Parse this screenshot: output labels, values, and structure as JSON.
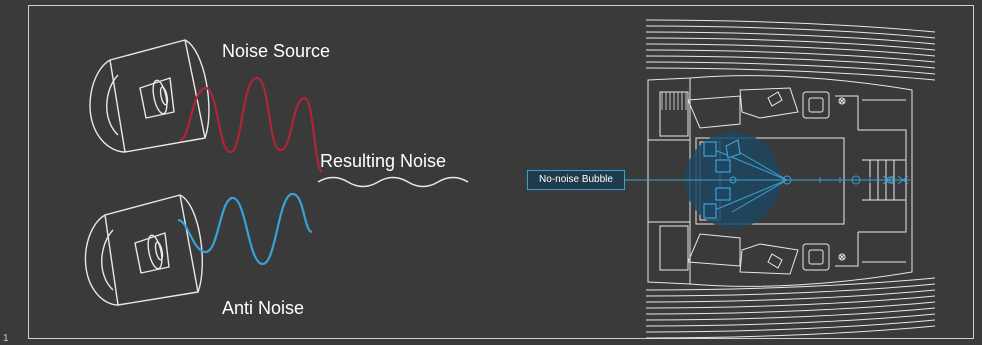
{
  "labels": {
    "noise_source": "Noise Source",
    "resulting_noise": "Resulting Noise",
    "anti_noise": "Anti Noise",
    "no_noise_bubble": "No-noise Bubble",
    "corner_number": "1"
  },
  "colors": {
    "background": "#3a3a3a",
    "line": "#e8e8e8",
    "noise_wave": "#b0243a",
    "anti_wave": "#3aa0d8",
    "bubble": "#1e4660",
    "accent": "#3aa0d8"
  }
}
